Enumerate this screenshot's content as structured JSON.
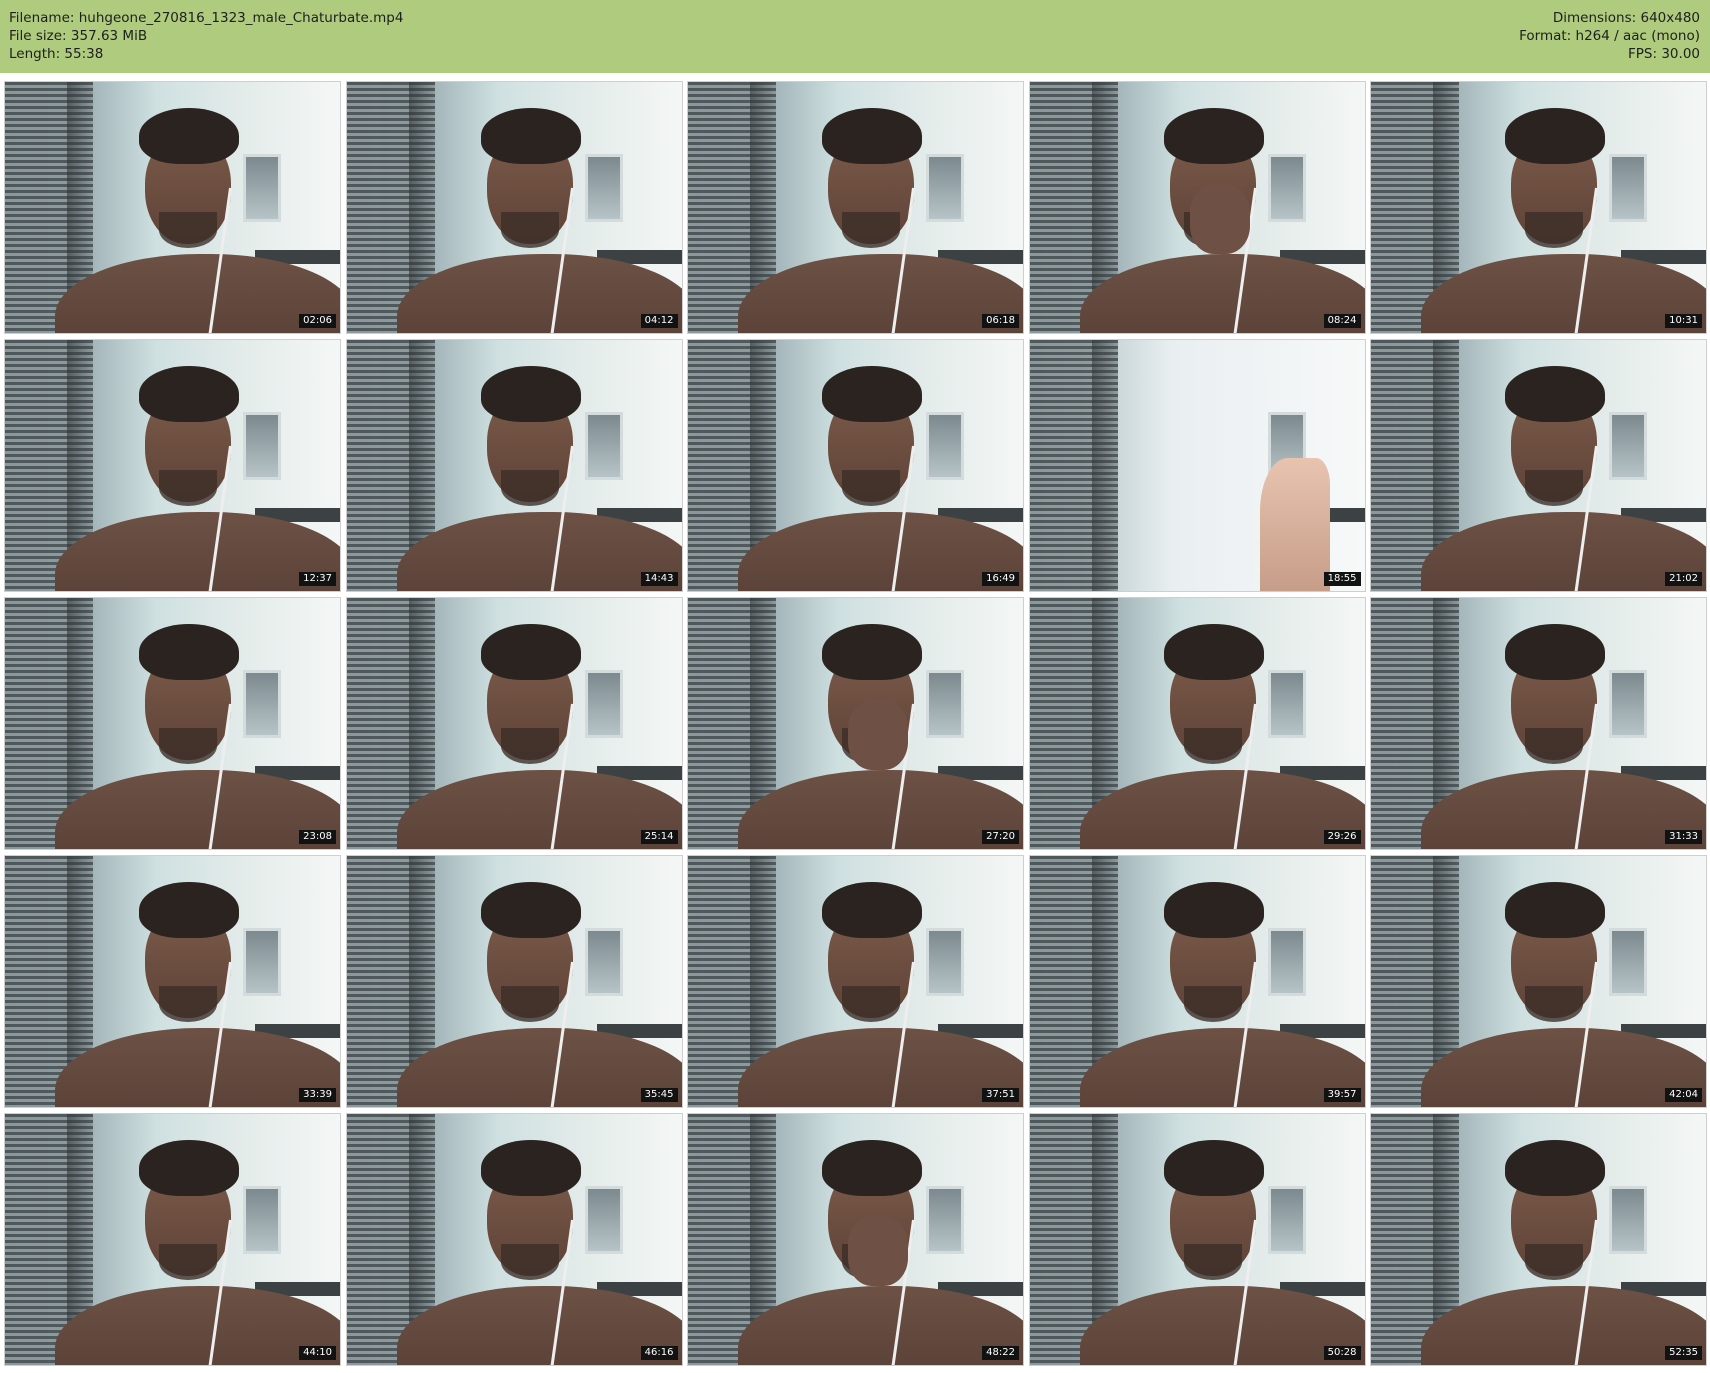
{
  "header": {
    "filename": "Filename: huhgeone_270816_1323_male_Chaturbate.mp4",
    "filesize": "File size: 357.63 MiB",
    "length": "Length: 55:38",
    "dimensions": "Dimensions: 640x480",
    "format": "Format: h264 / aac (mono)",
    "fps": "FPS: 30.00"
  },
  "thumbnails": [
    {
      "time": "02:06",
      "variant": "face"
    },
    {
      "time": "04:12",
      "variant": "face"
    },
    {
      "time": "06:18",
      "variant": "face"
    },
    {
      "time": "08:24",
      "variant": "hand-on-face"
    },
    {
      "time": "10:31",
      "variant": "face"
    },
    {
      "time": "12:37",
      "variant": "face"
    },
    {
      "time": "14:43",
      "variant": "face"
    },
    {
      "time": "16:49",
      "variant": "face"
    },
    {
      "time": "18:55",
      "variant": "empty-room"
    },
    {
      "time": "21:02",
      "variant": "face"
    },
    {
      "time": "23:08",
      "variant": "face"
    },
    {
      "time": "25:14",
      "variant": "face"
    },
    {
      "time": "27:20",
      "variant": "cover-face"
    },
    {
      "time": "29:26",
      "variant": "face"
    },
    {
      "time": "31:33",
      "variant": "face"
    },
    {
      "time": "33:39",
      "variant": "face"
    },
    {
      "time": "35:45",
      "variant": "face"
    },
    {
      "time": "37:51",
      "variant": "face"
    },
    {
      "time": "39:57",
      "variant": "face"
    },
    {
      "time": "42:04",
      "variant": "face"
    },
    {
      "time": "44:10",
      "variant": "face"
    },
    {
      "time": "46:16",
      "variant": "face"
    },
    {
      "time": "48:22",
      "variant": "hand-on-face"
    },
    {
      "time": "50:28",
      "variant": "face"
    },
    {
      "time": "52:35",
      "variant": "face"
    }
  ]
}
